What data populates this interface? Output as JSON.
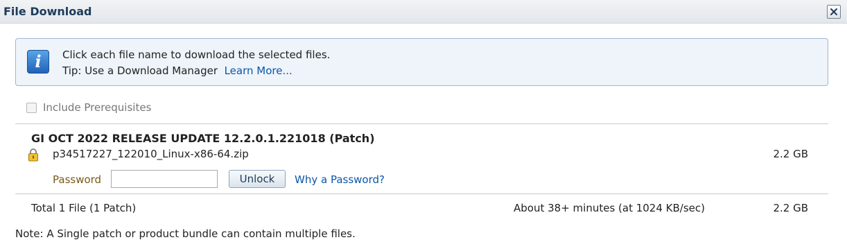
{
  "dialog": {
    "title": "File Download",
    "close_icon": "close-icon"
  },
  "info": {
    "icon": "info-icon",
    "icon_glyph": "i",
    "line1": "Click each file name to download the selected files.",
    "tip_text": "Tip: Use a Download Manager",
    "learn_more_label": "Learn More..."
  },
  "prerequisites": {
    "label": "Include Prerequisites",
    "checked": false,
    "disabled": true
  },
  "patch": {
    "title": "GI OCT 2022 RELEASE UPDATE 12.2.0.1.221018 (Patch)",
    "file": {
      "icon": "lock-icon",
      "name": "p34517227_122010_Linux-x86-64.zip",
      "size": "2.2 GB"
    },
    "password_label": "Password",
    "password_value": "",
    "unlock_label": "Unlock",
    "why_password_label": "Why a Password?"
  },
  "total": {
    "label": "Total 1 File (1 Patch)",
    "time_estimate": "About 38+ minutes (at 1024 KB/sec)",
    "size": "2.2 GB"
  },
  "note": "Note: A Single patch or product bundle can contain multiple files.",
  "colors": {
    "title_text": "#1d3b5a",
    "link": "#0a56a8",
    "info_background": "#eef4fa",
    "info_border": "#9fb6cc",
    "password_label": "#7a5a16"
  }
}
